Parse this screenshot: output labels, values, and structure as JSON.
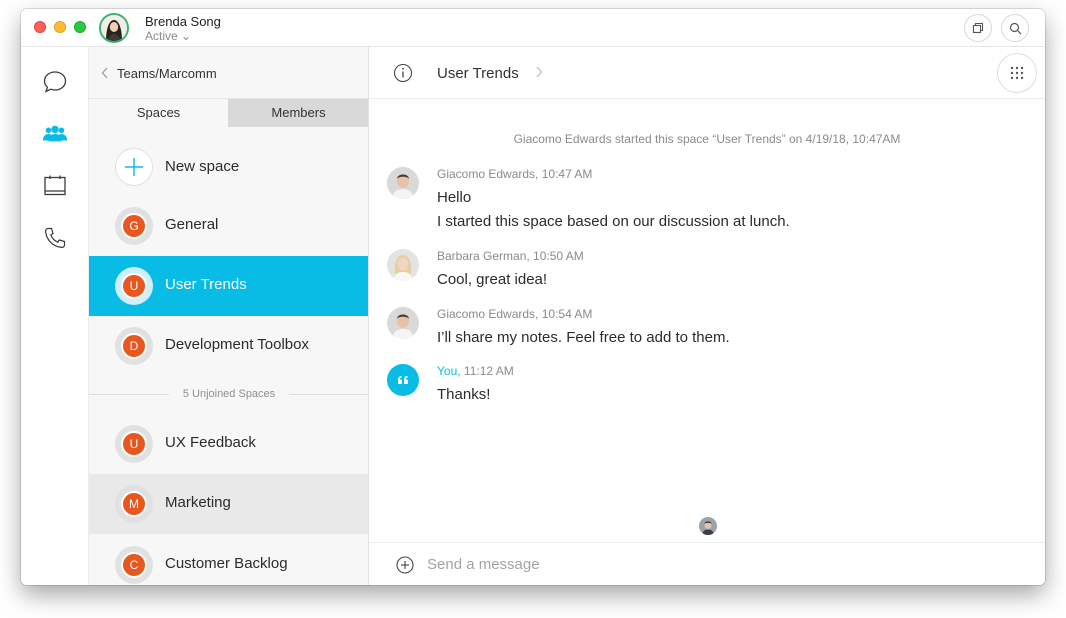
{
  "titlebar": {
    "user_name": "Brenda Song",
    "user_status": "Active",
    "status_chevron": "⌄"
  },
  "nav": {
    "icons": [
      "chat-bubble-icon",
      "teams-icon",
      "calendar-icon",
      "phone-icon"
    ],
    "active_index": 1
  },
  "breadcrumb": {
    "text": "Teams/Marcomm"
  },
  "tabs": {
    "spaces": "Spaces",
    "members": "Members"
  },
  "spaces": {
    "new_space_label": "New space",
    "joined": [
      {
        "initial": "G",
        "name": "General"
      },
      {
        "initial": "U",
        "name": "User Trends"
      },
      {
        "initial": "D",
        "name": "Development Toolbox"
      }
    ],
    "unjoined_label": "5 Unjoined Spaces",
    "unjoined": [
      {
        "initial": "U",
        "name": "UX Feedback"
      },
      {
        "initial": "M",
        "name": "Marketing"
      },
      {
        "initial": "C",
        "name": "Customer Backlog"
      }
    ]
  },
  "chat": {
    "title": "User Trends",
    "system_message": "Giacomo Edwards started this space “User Trends” on 4/19/18, 10:47AM",
    "messages": [
      {
        "author": "Giacomo Edwards",
        "time": "10:47 AM",
        "lines": [
          "Hello",
          "I started this space based on our discussion at lunch."
        ]
      },
      {
        "author": "Barbara German",
        "time": "10:50 AM",
        "lines": [
          "Cool, great idea!"
        ]
      },
      {
        "author": "Giacomo Edwards",
        "time": "10:54 AM",
        "lines": [
          "I’ll share my notes. Feel free to add to them."
        ]
      },
      {
        "author": "You",
        "time": "11:12 AM",
        "lines": [
          "Thanks!"
        ]
      }
    ],
    "composer_placeholder": "Send a message"
  },
  "colors": {
    "accent": "#08bce6",
    "space_avatar": "#e8571f",
    "active_status": "#3bb36b"
  }
}
